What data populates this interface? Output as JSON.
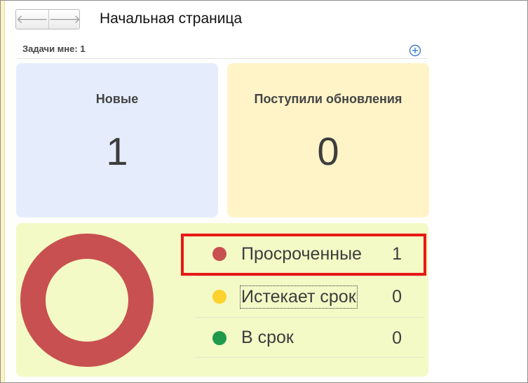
{
  "navigation": {
    "back_icon": "arrow-left-icon",
    "forward_icon": "arrow-right-icon",
    "back_glyph": "🡐",
    "forward_glyph": "🡒"
  },
  "page": {
    "title": "Начальная страница"
  },
  "tasks": {
    "header": "Задачи мне: 1",
    "add_icon": "plus-circle-icon",
    "tiles": [
      {
        "label": "Новые",
        "value": "1",
        "color": "#e5edfd"
      },
      {
        "label": "Поступили обновления",
        "value": "0",
        "color": "#fff4c8"
      }
    ],
    "status": {
      "panel_color": "#f3fac6",
      "donut_color": "#c85050",
      "items": [
        {
          "label": "Просроченные",
          "value": "1",
          "color": "#c85050"
        },
        {
          "label": "Истекает срок",
          "value": "0",
          "color": "#fdd22e"
        },
        {
          "label": "В срок",
          "value": "0",
          "color": "#1f9a4d"
        }
      ]
    }
  },
  "highlight": {
    "color": "#e81818"
  }
}
